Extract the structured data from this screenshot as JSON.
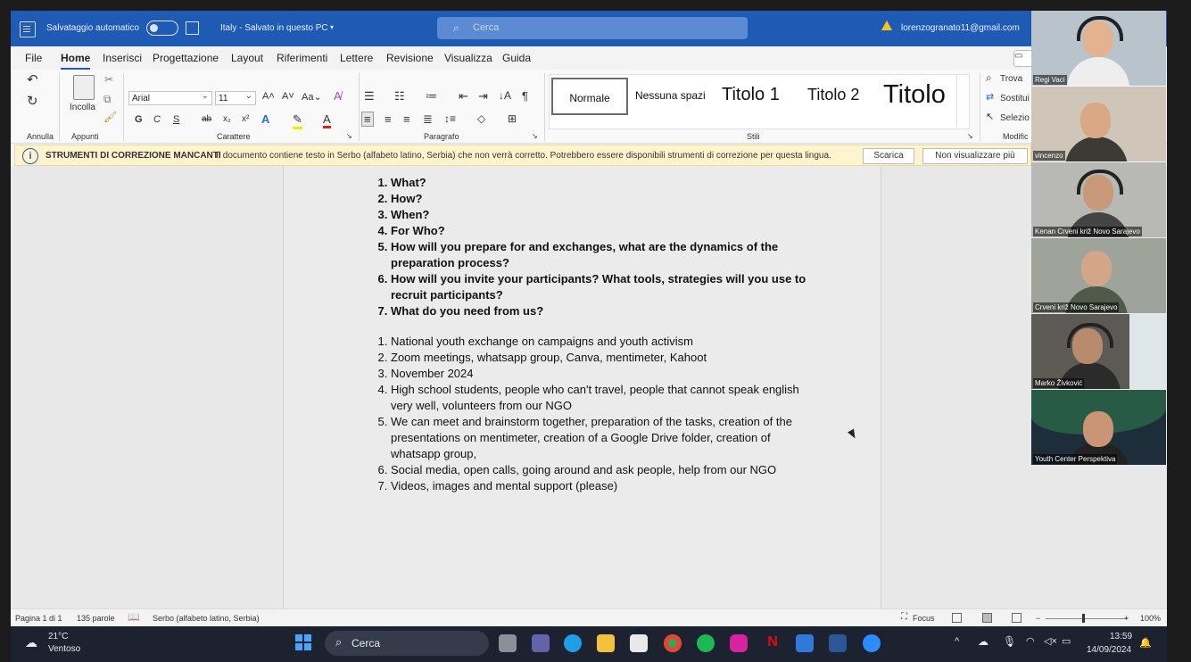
{
  "titlebar": {
    "autosave_label": "Salvataggio automatico",
    "doc_title": "Italy - Salvato in questo PC",
    "search_placeholder": "Cerca",
    "account": "lorenzogranato11@gmail.com"
  },
  "menu": [
    "File",
    "Home",
    "Inserisci",
    "Progettazione",
    "Layout",
    "Riferimenti",
    "Lettere",
    "Revisione",
    "Visualizza",
    "Guida"
  ],
  "ribbon": {
    "undo_group": "Annulla",
    "clipboard_group": "Appunti",
    "paste_label": "Incolla",
    "font_group": "Carattere",
    "font_name": "Arial",
    "font_size": "11",
    "paragraph_group": "Paragrafo",
    "styles_group": "Stili",
    "styles": [
      "Normale",
      "Nessuna spazi",
      "Titolo 1",
      "Titolo 2",
      "Titolo"
    ],
    "edit_group": "Modific",
    "find": "Trova",
    "replace": "Sostitui",
    "select": "Selezio"
  },
  "infobar": {
    "title": "STRUMENTI DI CORREZIONE MANCANTI",
    "message": "Il documento contiene testo in Serbo (alfabeto latino, Serbia) che non verrà corretto. Potrebbero essere disponibili strumenti di correzione per questa lingua.",
    "download": "Scarica",
    "dismiss": "Non visualizzare più"
  },
  "document": {
    "questions": [
      "What?",
      "How?",
      "When?",
      "For Who?",
      "How will you prepare for and exchanges, what are the dynamics of the preparation process?",
      "How will you invite your participants? What tools, strategies will you use to recruit participants?",
      "What do you need from us?"
    ],
    "answers": [
      "National youth exchange on campaigns and youth activism",
      "Zoom meetings, whatsapp group, Canva, mentimeter, Kahoot",
      "November 2024",
      "High school students, people who can't travel, people that cannot speak english very well, volunteers from our NGO",
      "We can meet and brainstorm together, preparation of the tasks, creation of the presentations on mentimeter, creation of a Google Drive folder, creation of whatsapp group,",
      "Social media, open calls, going around and ask people, help from our NGO",
      "Videos, images and mental support (please)"
    ]
  },
  "statusbar": {
    "page": "Pagina 1 di 1",
    "words": "135 parole",
    "language": "Serbo (alfabeto latino, Serbia)",
    "focus": "Focus",
    "zoom": "100%"
  },
  "taskbar": {
    "temp": "21°C",
    "weather": "Ventoso",
    "search": "Cerca",
    "time": "13:59",
    "date": "14/09/2024"
  },
  "participants": [
    "Regi Vaci",
    "vincenzo",
    "Kenan Crveni križ Novo Sarajevo",
    "Crveni križ Novo Sarajevo",
    "Marko Živković",
    "Youth Center Perspektiva"
  ],
  "colors": {
    "titlebar": "#1f5bb5",
    "infobar": "#fff4ce",
    "taskbar": "#1c2230"
  }
}
